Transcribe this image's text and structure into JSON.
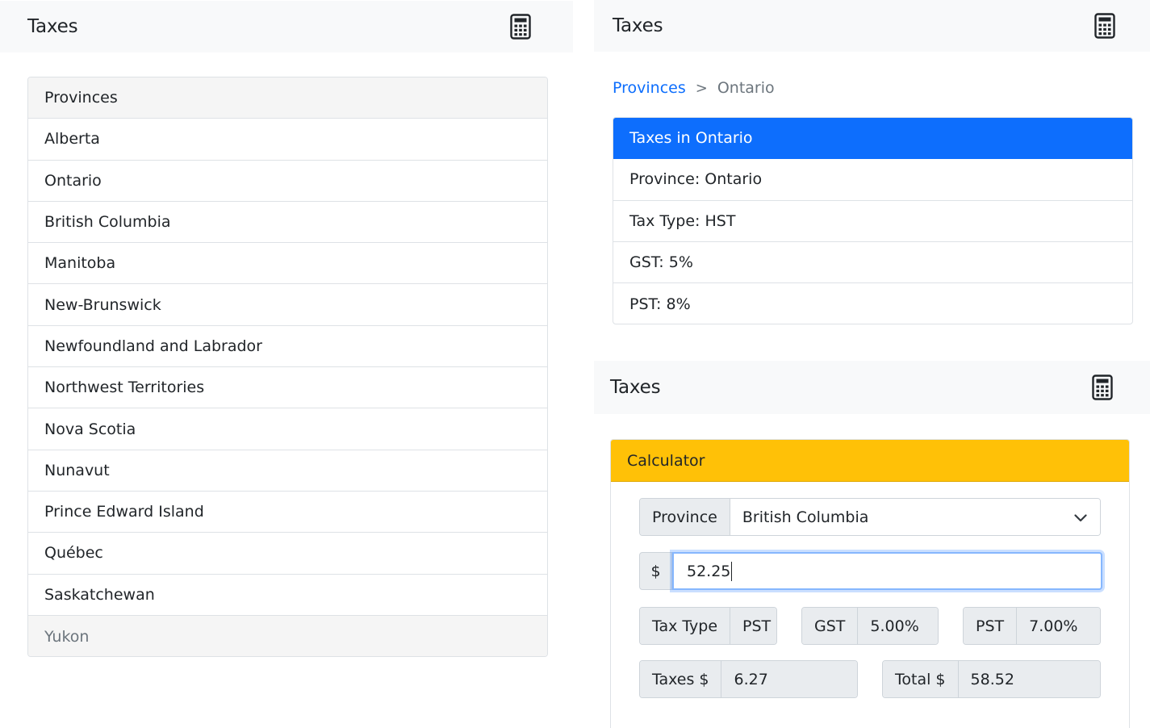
{
  "app": {
    "brand": "Taxes"
  },
  "provinces_panel": {
    "header": "Provinces",
    "items": [
      "Alberta",
      "Ontario",
      "British Columbia",
      "Manitoba",
      "New-Brunswick",
      "Newfoundland and Labrador",
      "Northwest Territories",
      "Nova Scotia",
      "Nunavut",
      "Prince Edward Island",
      "Québec",
      "Saskatchewan",
      "Yukon"
    ]
  },
  "breadcrumb": {
    "root": "Provinces",
    "separator": ">",
    "current": "Ontario"
  },
  "details": {
    "title": "Taxes in Ontario",
    "province": "Province: Ontario",
    "tax_type": "Tax Type: HST",
    "gst": "GST: 5%",
    "pst": "PST: 8%"
  },
  "calculator": {
    "header": "Calculator",
    "province_label": "Province",
    "province_value": "British Columbia",
    "currency_label": "$",
    "amount_value": "52.25",
    "tax_type_label": "Tax Type",
    "tax_type_value": "PST",
    "gst_label": "GST",
    "gst_value": "5.00%",
    "pst_label": "PST",
    "pst_value": "7.00%",
    "taxes_label": "Taxes $",
    "taxes_value": "6.27",
    "total_label": "Total $",
    "total_value": "58.52"
  },
  "colors": {
    "primary": "#0d6efd",
    "warning": "#ffc107",
    "navbar": "#f8f9fa"
  },
  "icons": {
    "navbar_icon": "calculator-icon",
    "select_icon": "chevron-down-icon"
  }
}
